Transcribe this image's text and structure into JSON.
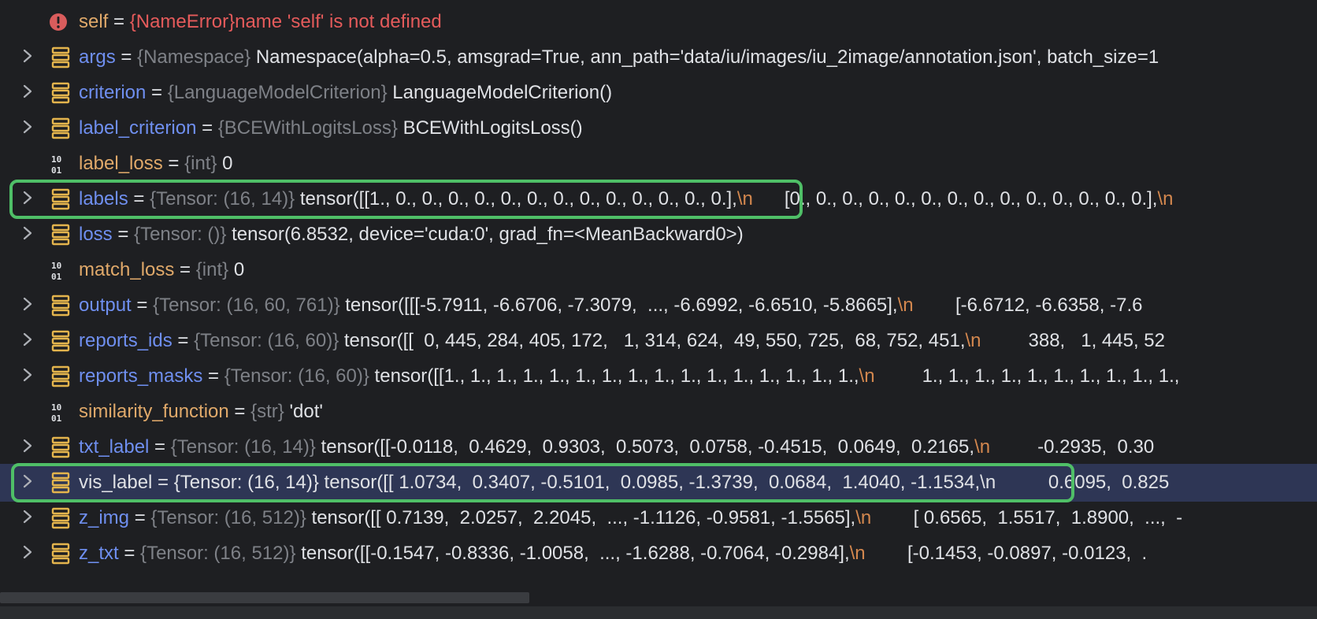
{
  "variables": [
    {
      "id": "self",
      "icon": "error",
      "expandable": false,
      "name": "self",
      "name_kind": "err",
      "type": "",
      "value": "{NameError}name 'self' is not defined",
      "value_kind": "error",
      "extra": ""
    },
    {
      "id": "args",
      "icon": "object",
      "expandable": true,
      "name": "args",
      "name_kind": "obj",
      "type": "{Namespace}",
      "value": "Namespace(alpha=0.5, amsgrad=True, ann_path='data/iu/images/iu_2image/annotation.json', batch_size=1",
      "value_kind": "normal",
      "extra": ""
    },
    {
      "id": "criterion",
      "icon": "object",
      "expandable": true,
      "name": "criterion",
      "name_kind": "obj",
      "type": "{LanguageModelCriterion}",
      "value": "LanguageModelCriterion()",
      "value_kind": "normal",
      "extra": ""
    },
    {
      "id": "label_criterion",
      "icon": "object",
      "expandable": true,
      "name": "label_criterion",
      "name_kind": "obj",
      "type": "{BCEWithLogitsLoss}",
      "value": "BCEWithLogitsLoss()",
      "value_kind": "normal",
      "extra": ""
    },
    {
      "id": "label_loss",
      "icon": "primitive",
      "expandable": false,
      "name": "label_loss",
      "name_kind": "prim",
      "type": "{int}",
      "value": "0",
      "value_kind": "normal",
      "extra": ""
    },
    {
      "id": "labels",
      "icon": "object",
      "expandable": true,
      "name": "labels",
      "name_kind": "obj",
      "type": "{Tensor: (16, 14)}",
      "value": "tensor([[1., 0., 0., 0., 0., 0., 0., 0., 0., 0., 0., 0., 0., 0.],",
      "value_kind": "normal",
      "esc": "\\n",
      "extra": "      [0., 0., 0., 0., 0., 0., 0., 0., 0., 0., 0., 0., 0., 0.],",
      "esc2": "\\n"
    },
    {
      "id": "loss",
      "icon": "object",
      "expandable": true,
      "name": "loss",
      "name_kind": "obj",
      "type": "{Tensor: ()}",
      "value": "tensor(6.8532, device='cuda:0', grad_fn=<MeanBackward0>)",
      "value_kind": "normal",
      "extra": ""
    },
    {
      "id": "match_loss",
      "icon": "primitive",
      "expandable": false,
      "name": "match_loss",
      "name_kind": "prim",
      "type": "{int}",
      "value": "0",
      "value_kind": "normal",
      "extra": ""
    },
    {
      "id": "output",
      "icon": "object",
      "expandable": true,
      "name": "output",
      "name_kind": "obj",
      "type": "{Tensor: (16, 60, 761)}",
      "value": "tensor([[[-5.7911, -6.6706, -7.3079,  ..., -6.6992, -6.6510, -5.8665],",
      "value_kind": "normal",
      "esc": "\\n",
      "extra": "        [-6.6712, -6.6358, -7.6",
      "esc2": ""
    },
    {
      "id": "reports_ids",
      "icon": "object",
      "expandable": true,
      "name": "reports_ids",
      "name_kind": "obj",
      "type": "{Tensor: (16, 60)}",
      "value": "tensor([[  0, 445, 284, 405, 172,   1, 314, 624,  49, 550, 725,  68, 752, 451,",
      "value_kind": "normal",
      "esc": "\\n",
      "extra": "         388,   1, 445, 52",
      "esc2": ""
    },
    {
      "id": "reports_masks",
      "icon": "object",
      "expandable": true,
      "name": "reports_masks",
      "name_kind": "obj",
      "type": "{Tensor: (16, 60)}",
      "value": "tensor([[1., 1., 1., 1., 1., 1., 1., 1., 1., 1., 1., 1., 1., 1., 1., 1.,",
      "value_kind": "normal",
      "esc": "\\n",
      "extra": "         1., 1., 1., 1., 1., 1., 1., 1., 1., 1.,",
      "esc2": ""
    },
    {
      "id": "similarity_function",
      "icon": "primitive",
      "expandable": false,
      "name": "similarity_function",
      "name_kind": "prim",
      "type": "{str}",
      "value": "'dot'",
      "value_kind": "normal",
      "extra": ""
    },
    {
      "id": "txt_label",
      "icon": "object",
      "expandable": true,
      "name": "txt_label",
      "name_kind": "obj",
      "type": "{Tensor: (16, 14)}",
      "value": "tensor([[-0.0118,  0.4629,  0.9303,  0.5073,  0.0758, -0.4515,  0.0649,  0.2165,",
      "value_kind": "normal",
      "esc": "\\n",
      "extra": "         -0.2935,  0.30",
      "esc2": ""
    },
    {
      "id": "vis_label",
      "icon": "object",
      "expandable": true,
      "selected": true,
      "name": "vis_label",
      "name_kind": "obj",
      "type": "{Tensor: (16, 14)}",
      "value": "tensor([[ 1.0734,  0.3407, -0.5101,  0.0985, -1.3739,  0.0684,  1.4040, -1.1534,",
      "value_kind": "normal",
      "esc": "\\n",
      "extra": "          0.6095,  0.825",
      "esc2": ""
    },
    {
      "id": "z_img",
      "icon": "object",
      "expandable": true,
      "name": "z_img",
      "name_kind": "obj",
      "type": "{Tensor: (16, 512)}",
      "value": "tensor([[ 0.7139,  2.0257,  2.2045,  ..., -1.1126, -0.9581, -1.5565],",
      "value_kind": "normal",
      "esc": "\\n",
      "extra": "        [ 0.6565,  1.5517,  1.8900,  ...,  -",
      "esc2": ""
    },
    {
      "id": "z_txt",
      "icon": "object",
      "expandable": true,
      "name": "z_txt",
      "name_kind": "obj",
      "type": "{Tensor: (16, 512)}",
      "value": "tensor([[-0.1547, -0.8336, -1.0058,  ..., -1.6288, -0.7064, -0.2984],",
      "value_kind": "normal",
      "esc": "\\n",
      "extra": "        [-0.1453, -0.0897, -0.0123,  .",
      "esc2": ""
    }
  ],
  "highlights": [
    "labels",
    "vis_label"
  ],
  "colors": {
    "background": "#1e1f22",
    "object_name": "#6f8ff0",
    "primitive_name": "#e0a96a",
    "type_hint": "#7e8187",
    "error": "#e55b5b",
    "escape": "#d3874e",
    "selection": "#2e3655",
    "highlight_box": "#4fbf67"
  }
}
